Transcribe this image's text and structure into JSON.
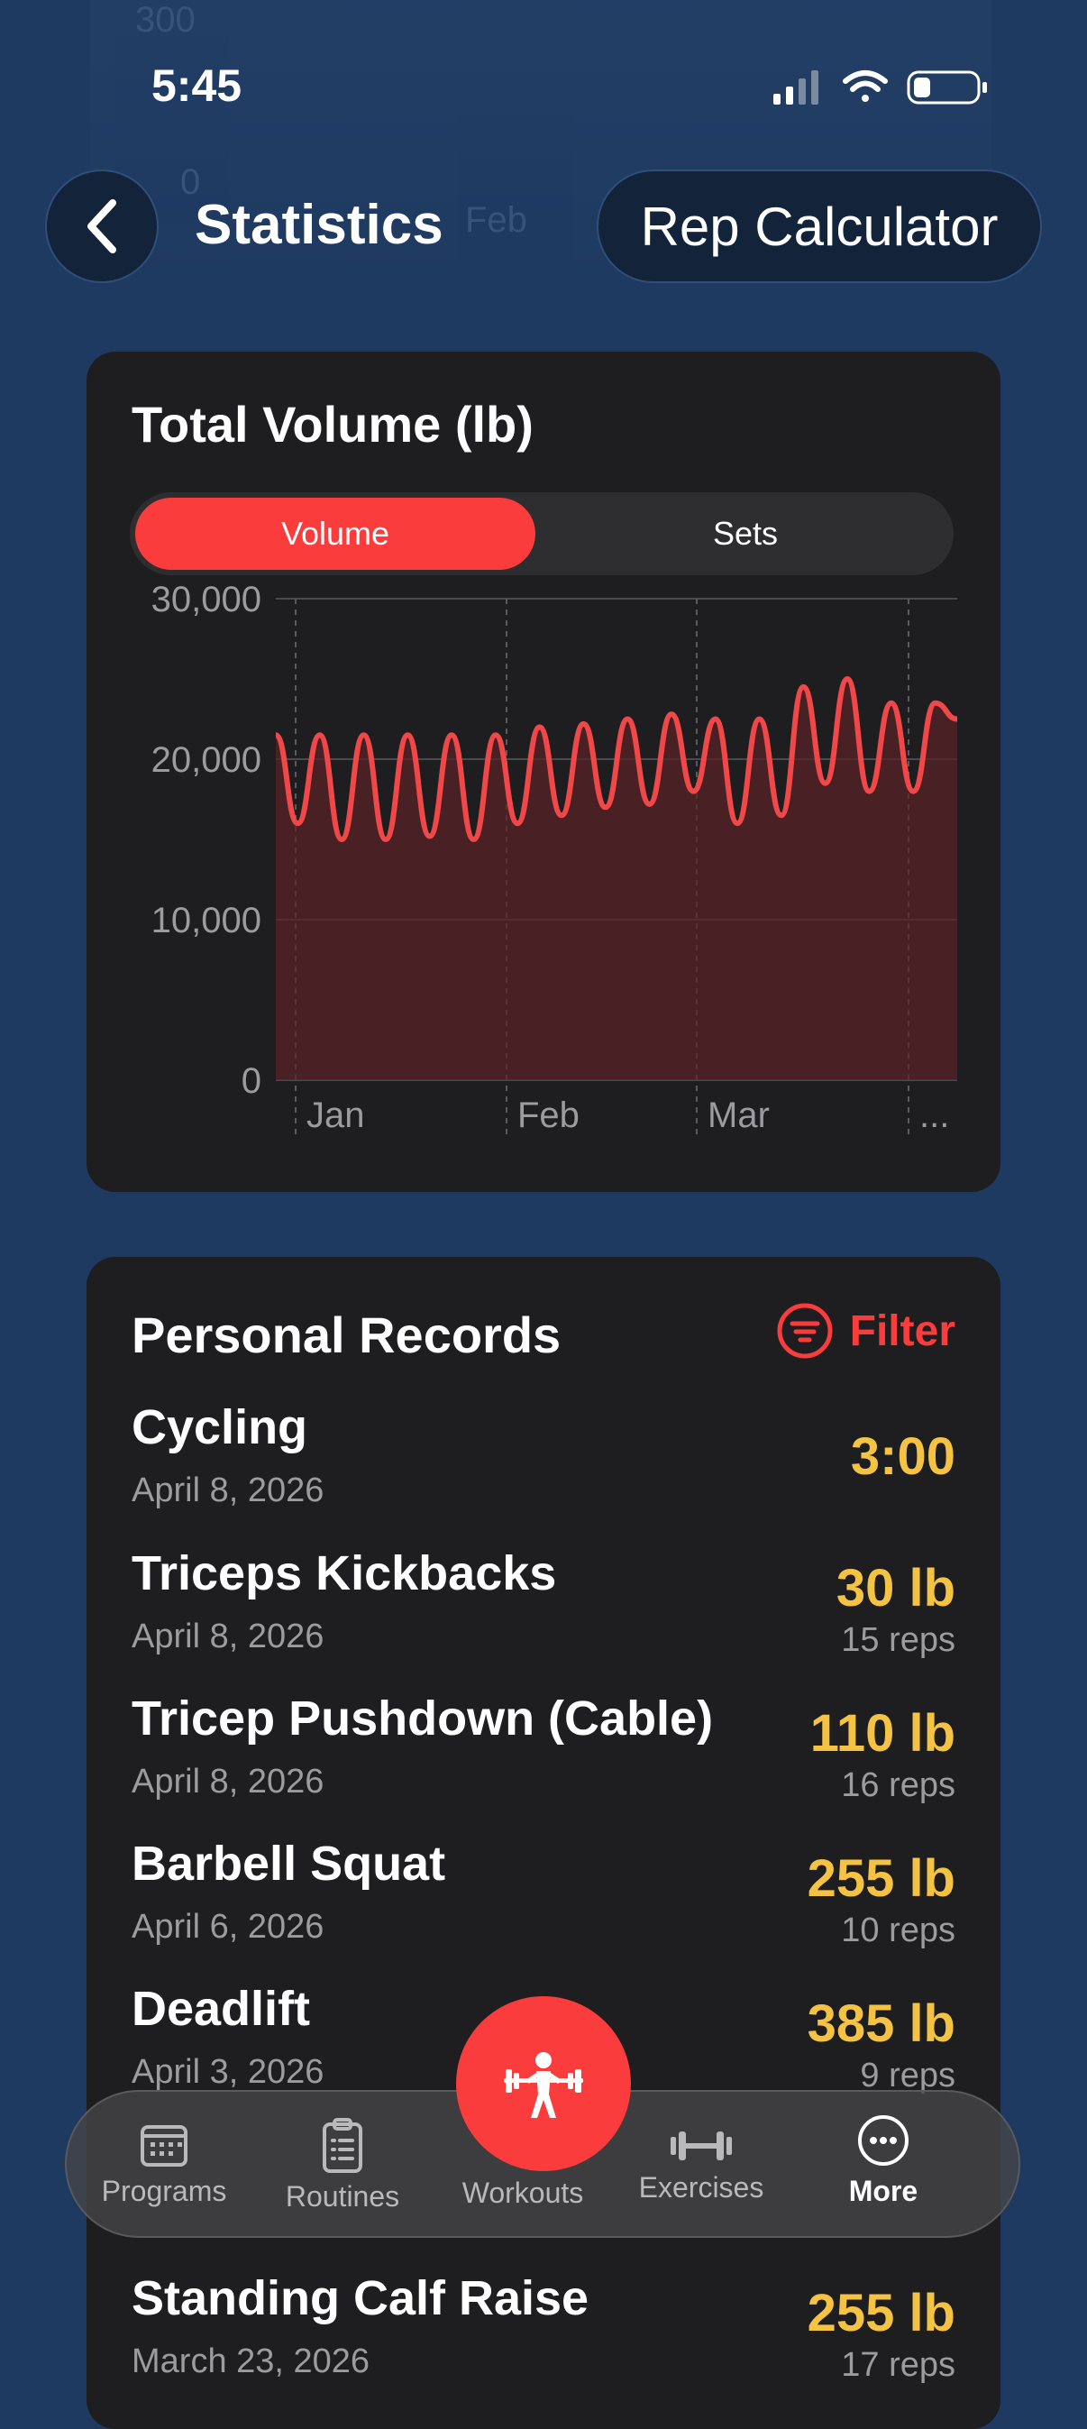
{
  "status": {
    "time": "5:45"
  },
  "ghost": {
    "top_value": "300",
    "mid_value": "0",
    "label": "Feb"
  },
  "header": {
    "title": "Statistics",
    "rep_calculator_label": "Rep Calculator"
  },
  "volume_card": {
    "title": "Total Volume (lb)",
    "segments": [
      "Volume",
      "Sets"
    ],
    "selected_segment": "Volume"
  },
  "chart_data": {
    "type": "area",
    "title": "Total Volume (lb)",
    "xlabel": "",
    "ylabel": "",
    "ylim": [
      0,
      30000
    ],
    "y_ticks": [
      "30,000",
      "20,000",
      "10,000",
      "0"
    ],
    "x_ticks": [
      "Jan",
      "Feb",
      "Mar",
      "..."
    ],
    "series": [
      {
        "color": "#f04848",
        "values": [
          21500,
          16000,
          21500,
          15000,
          21500,
          15000,
          21500,
          15200,
          21500,
          15000,
          21500,
          16000,
          22000,
          16500,
          22200,
          17000,
          22500,
          17200,
          22800,
          18000,
          22500,
          16000,
          22500,
          16500,
          24500,
          18500,
          25000,
          18000,
          23500,
          18000,
          23500,
          22500
        ]
      }
    ],
    "grid": true
  },
  "records_card": {
    "title": "Personal Records",
    "filter_label": "Filter",
    "records": [
      {
        "name": "Cycling",
        "date": "April 8, 2026",
        "value": "3:00",
        "reps": ""
      },
      {
        "name": "Triceps Kickbacks",
        "date": "April 8, 2026",
        "value": "30 lb",
        "reps": "15 reps"
      },
      {
        "name": "Tricep Pushdown (Cable)",
        "date": "April 8, 2026",
        "value": "110 lb",
        "reps": "16 reps"
      },
      {
        "name": "Barbell Squat",
        "date": "April 6, 2026",
        "value": "255 lb",
        "reps": "10 reps"
      },
      {
        "name": "Deadlift",
        "date": "April 3, 2026",
        "value": "385 lb",
        "reps": "9 reps"
      },
      {
        "name": "Standing Calf Raise",
        "date": "March 23, 2026",
        "value": "255 lb",
        "reps": "17 reps"
      }
    ]
  },
  "tabbar": {
    "tabs": [
      {
        "label": "Programs",
        "icon": "calendar-grid-icon"
      },
      {
        "label": "Routines",
        "icon": "clipboard-list-icon"
      },
      {
        "label": "Workouts",
        "icon": "weightlifter-icon"
      },
      {
        "label": "Exercises",
        "icon": "dumbbell-icon"
      },
      {
        "label": "More",
        "icon": "ellipsis-circle-icon"
      }
    ],
    "active": "More"
  },
  "colors": {
    "accent": "#fa3c3c",
    "record_value": "#f4c343",
    "background": "#1f3a61",
    "card": "#1e1e20"
  }
}
